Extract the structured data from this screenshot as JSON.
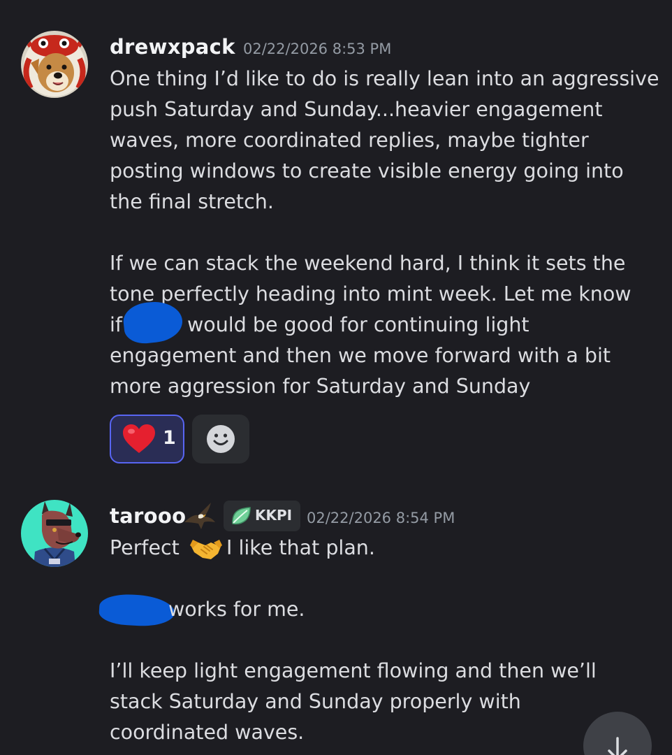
{
  "messages": [
    {
      "username": "drewxpack",
      "timestamp": "02/22/2026 8:53 PM",
      "avatar_icon": "corgi-crab-hat-avatar",
      "lines": [
        "One thing I’d like to do is really lean into an aggressive",
        "push Saturday and Sunday...heavier engagement",
        "waves, more coordinated replies, maybe tighter",
        "posting windows to create visible energy going into",
        "the final stretch.",
        "",
        "If we can stack the weekend hard, I think it sets the",
        "tone perfectly heading into mint week. Let me know",
        "if",
        "would be good for continuing light",
        "engagement and then we move forward with a bit",
        "more aggression for Saturday and Sunday"
      ],
      "reactions": [
        {
          "emoji": "❤️",
          "count": "1",
          "icon": "heart-icon"
        }
      ],
      "add_reaction_icon": "smiley-add-reaction-icon"
    },
    {
      "username": "tarooo",
      "timestamp": "02/22/2026 8:54 PM",
      "avatar_icon": "doberman-hoodie-avatar",
      "name_icon": "eagle-icon",
      "role": {
        "label": "KKPI",
        "icon": "leaf-icon",
        "color": "#6fcf97"
      },
      "lines": [
        "Perfect",
        "I like that plan.",
        "",
        "works for me.",
        "",
        "I’ll keep light engagement flowing and then we’ll",
        "stack Saturday and Sunday properly with",
        "coordinated waves."
      ],
      "inline_icon": "handshake-icon"
    }
  ],
  "scroll_button_icon": "arrow-down-icon",
  "colors": {
    "background": "#1d1d22",
    "text": "#dcdde1",
    "timestamp": "#949ba4",
    "accent": "#5865f2",
    "redaction": "#0a5bd6"
  }
}
